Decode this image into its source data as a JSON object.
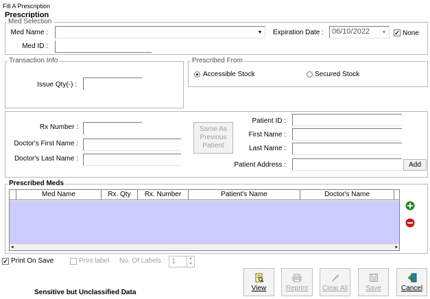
{
  "window": {
    "title": "Fill A Prescription"
  },
  "header": {
    "title": "Prescription"
  },
  "med_selection": {
    "legend": "Med Selection",
    "med_name_label": "Med Name :",
    "med_name_value": "",
    "med_id_label": "Med ID :",
    "med_id_value": "",
    "expiration_label": "Expiration Date :",
    "expiration_value": "06/10/2022",
    "none_label": "None",
    "none_checked": true
  },
  "transaction": {
    "legend": "Transaction Info",
    "issue_qty_label": "Issue Qty(-) :",
    "issue_qty_value": ""
  },
  "prescribed_from": {
    "legend": "Prescribed From",
    "options": [
      {
        "label": "Accessible Stock",
        "selected": true
      },
      {
        "label": "Secured Stock",
        "selected": false
      }
    ]
  },
  "rx_info": {
    "rx_number_label": "Rx Number :",
    "doctor_first_label": "Doctor's First Name :",
    "doctor_last_label": "Doctor's Last Name :",
    "same_as_previous_line1": "Same As",
    "same_as_previous_line2": "Previous",
    "same_as_previous_line3": "Patient",
    "patient_id_label": "Patient ID :",
    "first_name_label": "First Name :",
    "last_name_label": "Last Name :",
    "patient_address_label": "Patient Address :",
    "add_button": "Add"
  },
  "prescribed_meds": {
    "legend": "Prescribed Meds",
    "columns": [
      "Med Name",
      "Rx. Qty",
      "Rx. Number",
      "Patient's Name",
      "Doctor's Name"
    ],
    "rows": []
  },
  "print_options": {
    "print_on_save_label": "Print On Save",
    "print_on_save_checked": true,
    "print_label_label": "Print label",
    "print_label_checked": false,
    "num_labels_label": "No. Of Labels :",
    "num_labels_value": "1"
  },
  "footer": {
    "notice": "Sensitive but Unclassified  Data"
  },
  "toolbar": {
    "view": "View",
    "reprint": "Reprint",
    "clear_all": "Clear All",
    "save": "Save",
    "cancel": "Cancel"
  },
  "colors": {
    "grid_body": "#ccccff",
    "add_icon": "#1a8a1a",
    "remove_icon": "#d01818"
  }
}
